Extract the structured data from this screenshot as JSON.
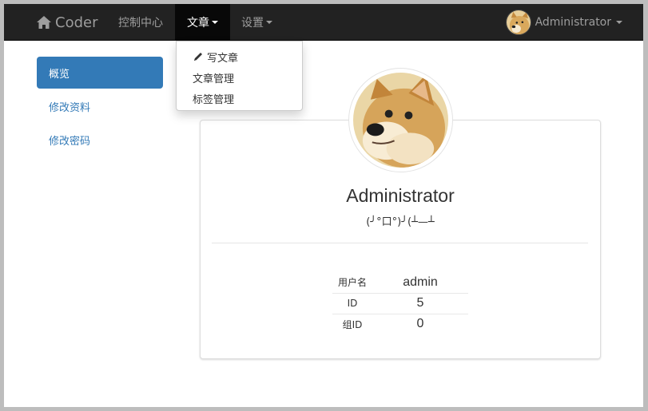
{
  "navbar": {
    "brand": "Coder",
    "items": [
      {
        "label": "控制中心"
      },
      {
        "label": "文章"
      },
      {
        "label": "设置"
      }
    ],
    "user": "Administrator"
  },
  "dropdown": {
    "items": [
      {
        "label": "写文章",
        "icon": "pencil-icon"
      },
      {
        "label": "文章管理"
      },
      {
        "label": "标签管理"
      }
    ]
  },
  "sidebar": {
    "items": [
      {
        "label": "概览",
        "active": true
      },
      {
        "label": "修改资料"
      },
      {
        "label": "修改密码"
      }
    ]
  },
  "profile": {
    "name": "Administrator",
    "motto": "(╯°口°)╯(┴—┴",
    "fields": [
      {
        "key": "用户名",
        "value": "admin"
      },
      {
        "key": "ID",
        "value": "5"
      },
      {
        "key": "组ID",
        "value": "0"
      }
    ]
  },
  "colors": {
    "navbar_bg": "#222222",
    "accent": "#337ab7",
    "nav_text": "#9d9d9d"
  }
}
